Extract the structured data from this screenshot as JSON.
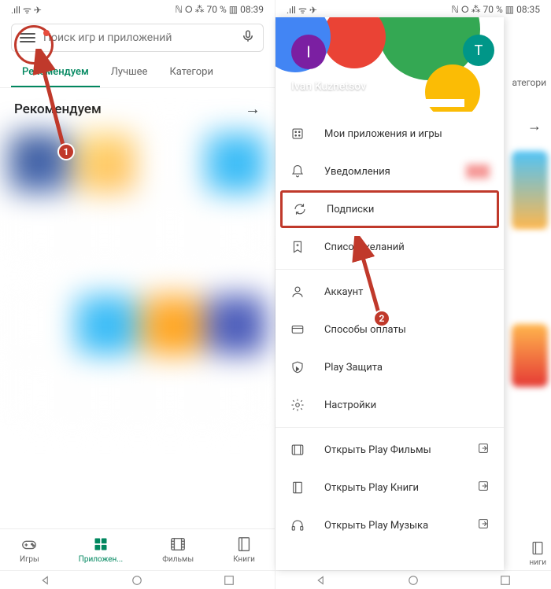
{
  "left": {
    "status": {
      "left_icons": ".ıll ᯤ ✈",
      "right_icons": "ℕ ⭘ ⁂ 70 % ▥ 08:39"
    },
    "search": {
      "placeholder": "Поиск игр и приложений"
    },
    "tabs": [
      {
        "label": "Рекомендуем",
        "active": true
      },
      {
        "label": "Лучшее",
        "active": false
      },
      {
        "label": "Категори",
        "active": false
      }
    ],
    "section_title": "Рекомендуем",
    "bottom_nav": [
      {
        "label": "Игры"
      },
      {
        "label": "Приложен..."
      },
      {
        "label": "Фильмы"
      },
      {
        "label": "Книги"
      }
    ]
  },
  "right": {
    "status": {
      "left_icons": ".ıll ᯤ ✈",
      "right_icons": "ℕ ⭘ ⁂ 70 % ▥ 08:35"
    },
    "user": {
      "name": "Ivan Kuznetsov",
      "initial_main": "I",
      "initial_alt": "T"
    },
    "items_top": [
      {
        "label": "Мои приложения и игры"
      },
      {
        "label": "Уведомления"
      },
      {
        "label": "Подписки"
      },
      {
        "label": "Список желаний"
      }
    ],
    "items_mid": [
      {
        "label": "Аккаунт"
      },
      {
        "label": "Способы оплаты"
      },
      {
        "label": "Play Защита"
      },
      {
        "label": "Настройки"
      }
    ],
    "items_bot": [
      {
        "label": "Открыть Play Фильмы"
      },
      {
        "label": "Открыть Play Книги"
      },
      {
        "label": "Открыть Play Музыка"
      }
    ],
    "peek": {
      "tab": "атегори",
      "nav": "ниги"
    }
  },
  "annotations": {
    "badge1": "1",
    "badge2": "2"
  }
}
